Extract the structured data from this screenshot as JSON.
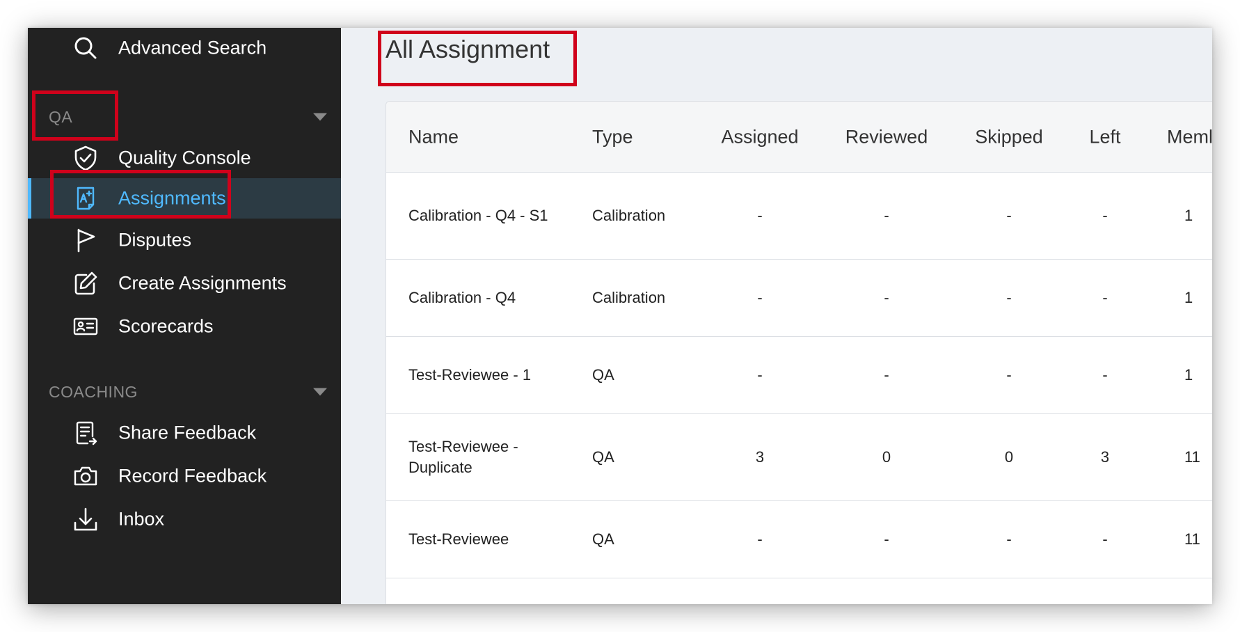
{
  "sidebar": {
    "top_item": {
      "label": "Advanced Search",
      "icon": "search-icon"
    },
    "sections": [
      {
        "title": "QA",
        "items": [
          {
            "label": "Quality Console",
            "icon": "shield-check-icon"
          },
          {
            "label": "Assignments",
            "icon": "assignment-document-icon",
            "active": true
          },
          {
            "label": "Disputes",
            "icon": "flag-icon"
          },
          {
            "label": "Create Assignments",
            "icon": "edit-icon"
          },
          {
            "label": "Scorecards",
            "icon": "id-card-icon"
          }
        ]
      },
      {
        "title": "COACHING",
        "items": [
          {
            "label": "Share Feedback",
            "icon": "share-document-icon"
          },
          {
            "label": "Record Feedback",
            "icon": "camera-icon"
          },
          {
            "label": "Inbox",
            "icon": "download-tray-icon"
          }
        ]
      }
    ]
  },
  "main": {
    "title": "All Assignment",
    "table": {
      "headers": [
        "Name",
        "Type",
        "Assigned",
        "Reviewed",
        "Skipped",
        "Left",
        "Meml"
      ],
      "rows": [
        {
          "name": "Calibration - Q4 - S1",
          "type": "Calibration",
          "assigned": "-",
          "reviewed": "-",
          "skipped": "-",
          "left": "-",
          "members": "1"
        },
        {
          "name": "Calibration - Q4",
          "type": "Calibration",
          "assigned": "-",
          "reviewed": "-",
          "skipped": "-",
          "left": "-",
          "members": "1"
        },
        {
          "name": "Test-Reviewee - 1",
          "type": "QA",
          "assigned": "-",
          "reviewed": "-",
          "skipped": "-",
          "left": "-",
          "members": "1"
        },
        {
          "name": "Test-Reviewee - Duplicate",
          "type": "QA",
          "assigned": "3",
          "reviewed": "0",
          "skipped": "0",
          "left": "3",
          "members": "11"
        },
        {
          "name": "Test-Reviewee",
          "type": "QA",
          "assigned": "-",
          "reviewed": "-",
          "skipped": "-",
          "left": "-",
          "members": "11"
        }
      ]
    }
  },
  "colors": {
    "sidebar_bg": "#222222",
    "active_bg": "#2c3b44",
    "accent": "#4fb9ff",
    "highlight": "#d0021b",
    "main_bg": "#edf0f4"
  }
}
